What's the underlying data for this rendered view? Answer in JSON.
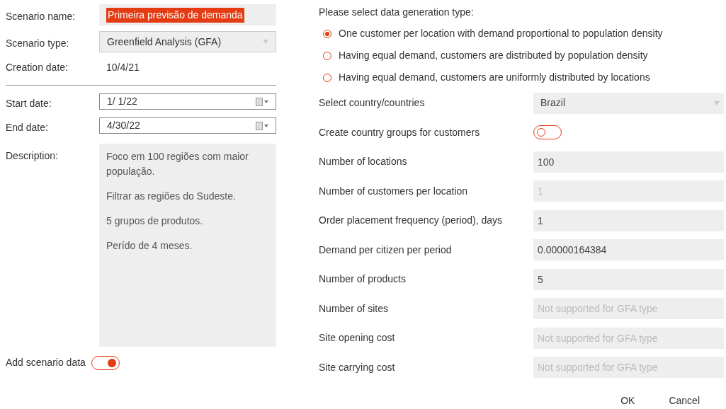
{
  "scenario": {
    "fields": [
      {
        "kind": "text",
        "label": "Scenario name:",
        "value": "Primeira previsão de demanda",
        "text_selected": true
      },
      {
        "kind": "select",
        "label": "Scenario type:",
        "value": "Greenfield Analysis (GFA)"
      },
      {
        "kind": "static",
        "label": "Creation date:",
        "value": "10/4/21"
      },
      {
        "kind": "divider"
      },
      {
        "kind": "date",
        "label": "Start date:",
        "value": "1/  1/22"
      },
      {
        "kind": "date",
        "label": "End date:",
        "value": "4/30/22"
      },
      {
        "kind": "textarea",
        "label": "Description:",
        "paragraphs": [
          "Foco em 100 regiões com maior população.",
          "Filtrar as regiões do Sudeste.",
          "5 grupos de produtos.",
          "Perído de 4 meses."
        ]
      }
    ],
    "add_scenario_data": {
      "label": "Add scenario data",
      "on": true
    }
  },
  "generation": {
    "title": "Please select data generation type:",
    "options": [
      {
        "label": "One customer per location with demand proportional to population density",
        "selected": true
      },
      {
        "label": "Having equal demand, customers are distributed by population density",
        "selected": false
      },
      {
        "label": "Having equal demand, customers are uniformly distributed by locations",
        "selected": false
      }
    ],
    "settings": [
      {
        "kind": "select",
        "label": "Select country/countries",
        "value": "Brazil"
      },
      {
        "kind": "toggle",
        "label": "Create country groups for customers",
        "on": false
      },
      {
        "kind": "input",
        "label": "Number of locations",
        "value": "100",
        "disabled": false
      },
      {
        "kind": "input",
        "label": "Number of customers per location",
        "value": "1",
        "disabled": true
      },
      {
        "kind": "input",
        "label": "Order placement frequency (period), days",
        "value": "1",
        "disabled": false
      },
      {
        "kind": "input",
        "label": "Demand per citizen per period",
        "value": "0.00000164384",
        "disabled": false
      },
      {
        "kind": "input",
        "label": "Number of products",
        "value": "5",
        "disabled": false
      },
      {
        "kind": "input",
        "label": "Number of sites",
        "value": "Not supported for GFA type",
        "disabled": true
      },
      {
        "kind": "input",
        "label": "Site opening cost",
        "value": "Not supported for GFA type",
        "disabled": true
      },
      {
        "kind": "input",
        "label": "Site carrying cost",
        "value": "Not supported for GFA type",
        "disabled": true
      }
    ]
  },
  "buttons": [
    "OK",
    "Cancel"
  ]
}
